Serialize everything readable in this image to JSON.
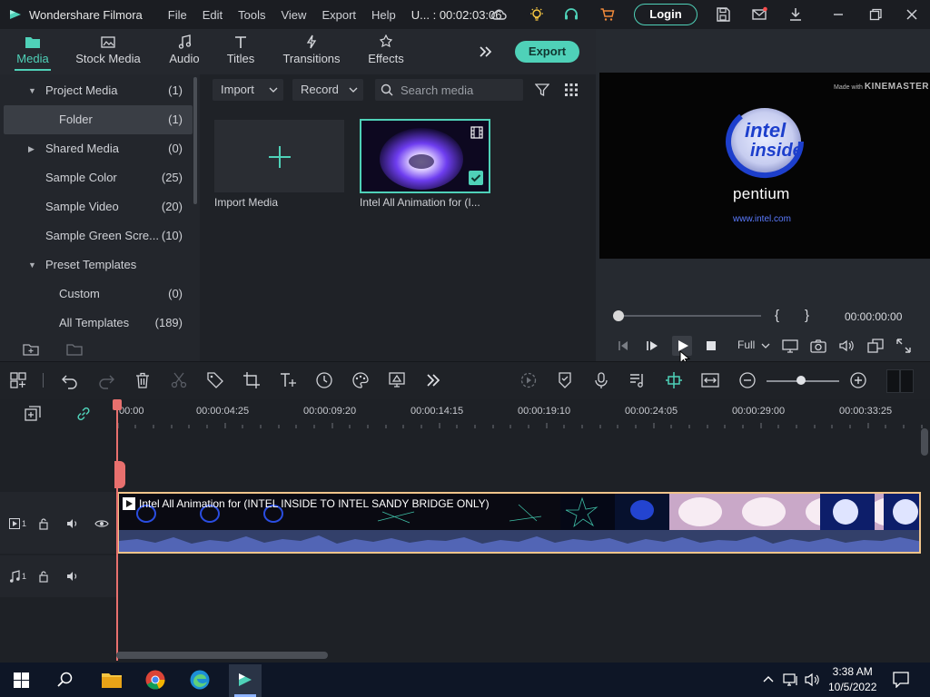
{
  "titlebar": {
    "app_name": "Wondershare Filmora",
    "menu": [
      "File",
      "Edit",
      "Tools",
      "View",
      "Export",
      "Help"
    ],
    "project": "U... : 00:02:03:06",
    "login_label": "Login"
  },
  "tabs": [
    {
      "label": "Media",
      "icon": "folder-icon",
      "active": true
    },
    {
      "label": "Stock Media",
      "icon": "stock-media-icon",
      "active": false
    },
    {
      "label": "Audio",
      "icon": "music-note-icon",
      "active": false
    },
    {
      "label": "Titles",
      "icon": "text-t-icon",
      "active": false
    },
    {
      "label": "Transitions",
      "icon": "transition-icon",
      "active": false
    },
    {
      "label": "Effects",
      "icon": "effects-icon",
      "active": false
    }
  ],
  "export_label": "Export",
  "sidebar": {
    "items": [
      {
        "label": "Project Media",
        "count": "(1)",
        "expand": "▼",
        "indent": 1
      },
      {
        "label": "Folder",
        "count": "(1)",
        "expand": "",
        "indent": 2,
        "selected": true
      },
      {
        "label": "Shared Media",
        "count": "(0)",
        "expand": "▶",
        "indent": 1
      },
      {
        "label": "Sample Color",
        "count": "(25)",
        "expand": "",
        "indent": 1
      },
      {
        "label": "Sample Video",
        "count": "(20)",
        "expand": "",
        "indent": 1
      },
      {
        "label": "Sample Green Scre...",
        "count": "(10)",
        "expand": "",
        "indent": 1
      },
      {
        "label": "Preset Templates",
        "count": "",
        "expand": "▼",
        "indent": 1
      },
      {
        "label": "Custom",
        "count": "(0)",
        "expand": "",
        "indent": 2
      },
      {
        "label": "All Templates",
        "count": "(189)",
        "expand": "",
        "indent": 2
      }
    ]
  },
  "media": {
    "import_label": "Import",
    "record_label": "Record",
    "search_placeholder": "Search media",
    "import_media_label": "Import Media",
    "clip_label": "Intel All Animation for (I..."
  },
  "preview": {
    "watermark_small": "Made with",
    "watermark_brand": "KINEMASTER",
    "logo_line1": "intel",
    "logo_line2": "inside",
    "logo_pentium": "pentium",
    "logo_url": "www.intel.com",
    "bracket_in": "{",
    "bracket_out": "}",
    "timecode": "00:00:00:00",
    "quality": "Full"
  },
  "timeline": {
    "ruler_labels": [
      "00:00",
      "00:00:04:25",
      "00:00:09:20",
      "00:00:14:15",
      "00:00:19:10",
      "00:00:24:05",
      "00:00:29:00",
      "00:00:33:25"
    ],
    "clip_title": "Intel All Animation for (INTEL INSIDE TO INTEL SANDY BRIDGE ONLY)",
    "video_track_num": "1",
    "audio_track_num": "1"
  },
  "taskbar": {
    "time": "3:38 AM",
    "date": "10/5/2022"
  },
  "colors": {
    "accent": "#4fd1b8",
    "playhead": "#e8706e",
    "clip_border": "#f0c48a"
  }
}
